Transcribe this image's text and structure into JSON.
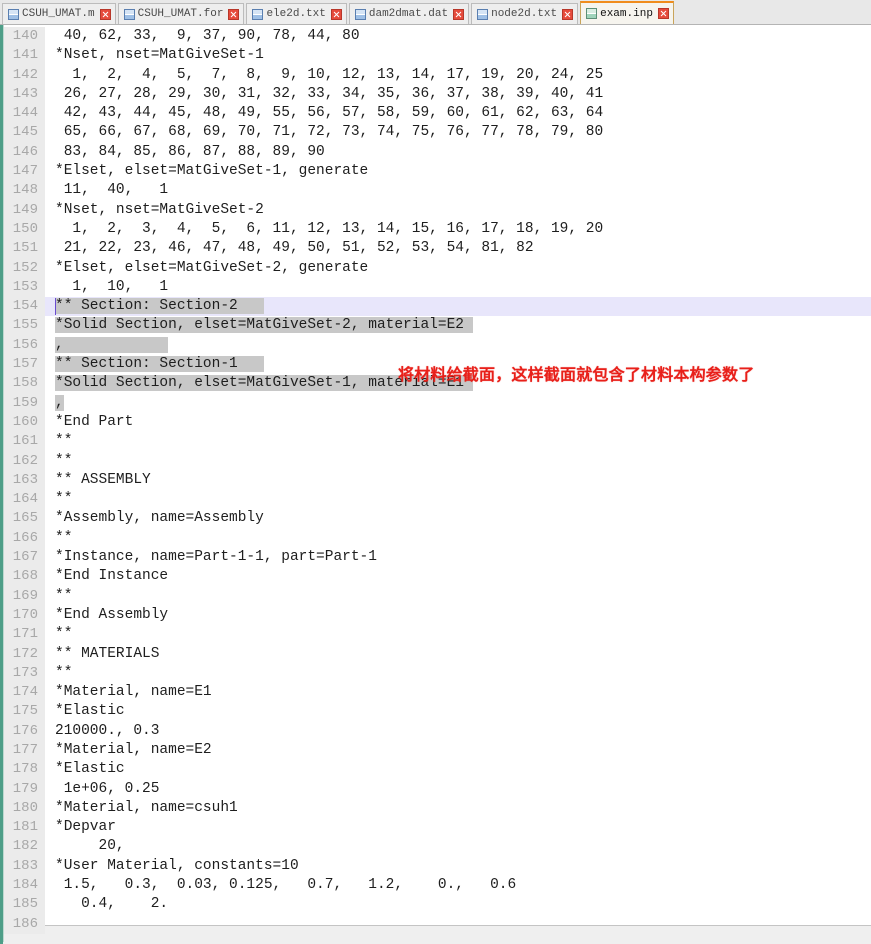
{
  "window": {
    "app_kind": "text-editor",
    "active_file": "exam.inp"
  },
  "colors": {
    "accent_tab_active": "#f08c1c",
    "gutter_bg": "#ebebeb",
    "gutter_text": "#a8a8a8",
    "selection_bg": "#c8c8c8",
    "current_line_bg": "#e8e6fb",
    "annotation_red": "#e8201a",
    "left_rail_green": "#4e9e88",
    "code_text": "#1e1e1e"
  },
  "tabs": [
    {
      "label": "CSUH_UMAT.m",
      "icon": "file-icon",
      "close_icon": "close-icon",
      "active": false
    },
    {
      "label": "CSUH_UMAT.for",
      "icon": "file-icon",
      "close_icon": "close-icon",
      "active": false
    },
    {
      "label": "ele2d.txt",
      "icon": "file-icon",
      "close_icon": "close-icon",
      "active": false
    },
    {
      "label": "dam2dmat.dat",
      "icon": "file-icon",
      "close_icon": "close-icon",
      "active": false
    },
    {
      "label": "node2d.txt",
      "icon": "file-icon",
      "close_icon": "close-icon",
      "active": false
    },
    {
      "label": "exam.inp",
      "icon": "file-icon",
      "close_icon": "close-icon",
      "active": true
    }
  ],
  "annotation": {
    "text": "将材料给截面，这样截面就包含了材料本构参数了"
  },
  "editor": {
    "first_line_number": 140,
    "last_line_number": 186,
    "current_line_number": 154,
    "selection_start_line": 154,
    "selection_end_line": 159,
    "lines": [
      {
        "n": 140,
        "text": " 40, 62, 33,  9, 37, 90, 78, 44, 80",
        "sel": 0
      },
      {
        "n": 141,
        "text": "*Nset, nset=MatGiveSet-1",
        "sel": 0
      },
      {
        "n": 142,
        "text": "  1,  2,  4,  5,  7,  8,  9, 10, 12, 13, 14, 17, 19, 20, 24, 25",
        "sel": 0
      },
      {
        "n": 143,
        "text": " 26, 27, 28, 29, 30, 31, 32, 33, 34, 35, 36, 37, 38, 39, 40, 41",
        "sel": 0
      },
      {
        "n": 144,
        "text": " 42, 43, 44, 45, 48, 49, 55, 56, 57, 58, 59, 60, 61, 62, 63, 64",
        "sel": 0
      },
      {
        "n": 145,
        "text": " 65, 66, 67, 68, 69, 70, 71, 72, 73, 74, 75, 76, 77, 78, 79, 80",
        "sel": 0
      },
      {
        "n": 146,
        "text": " 83, 84, 85, 86, 87, 88, 89, 90",
        "sel": 0
      },
      {
        "n": 147,
        "text": "*Elset, elset=MatGiveSet-1, generate",
        "sel": 0
      },
      {
        "n": 148,
        "text": " 11,  40,   1",
        "sel": 0
      },
      {
        "n": 149,
        "text": "*Nset, nset=MatGiveSet-2",
        "sel": 0
      },
      {
        "n": 150,
        "text": "  1,  2,  3,  4,  5,  6, 11, 12, 13, 14, 15, 16, 17, 18, 19, 20",
        "sel": 0
      },
      {
        "n": 151,
        "text": " 21, 22, 23, 46, 47, 48, 49, 50, 51, 52, 53, 54, 81, 82",
        "sel": 0
      },
      {
        "n": 152,
        "text": "*Elset, elset=MatGiveSet-2, generate",
        "sel": 0
      },
      {
        "n": 153,
        "text": "  1,  10,   1",
        "sel": 0
      },
      {
        "n": 154,
        "text": "** Section: Section-2",
        "sel": 24
      },
      {
        "n": 155,
        "text": "*Solid Section, elset=MatGiveSet-2, material=E2",
        "sel": 48
      },
      {
        "n": 156,
        "text": ",",
        "sel": 13
      },
      {
        "n": 157,
        "text": "** Section: Section-1",
        "sel": 24
      },
      {
        "n": 158,
        "text": "*Solid Section, elset=MatGiveSet-1, material=E1",
        "sel": 48
      },
      {
        "n": 159,
        "text": ",",
        "sel": 1
      },
      {
        "n": 160,
        "text": "*End Part",
        "sel": 0
      },
      {
        "n": 161,
        "text": "**",
        "sel": 0
      },
      {
        "n": 162,
        "text": "**",
        "sel": 0
      },
      {
        "n": 163,
        "text": "** ASSEMBLY",
        "sel": 0
      },
      {
        "n": 164,
        "text": "**",
        "sel": 0
      },
      {
        "n": 165,
        "text": "*Assembly, name=Assembly",
        "sel": 0
      },
      {
        "n": 166,
        "text": "**",
        "sel": 0
      },
      {
        "n": 167,
        "text": "*Instance, name=Part-1-1, part=Part-1",
        "sel": 0
      },
      {
        "n": 168,
        "text": "*End Instance",
        "sel": 0
      },
      {
        "n": 169,
        "text": "**",
        "sel": 0
      },
      {
        "n": 170,
        "text": "*End Assembly",
        "sel": 0
      },
      {
        "n": 171,
        "text": "**",
        "sel": 0
      },
      {
        "n": 172,
        "text": "** MATERIALS",
        "sel": 0
      },
      {
        "n": 173,
        "text": "**",
        "sel": 0
      },
      {
        "n": 174,
        "text": "*Material, name=E1",
        "sel": 0
      },
      {
        "n": 175,
        "text": "*Elastic",
        "sel": 0
      },
      {
        "n": 176,
        "text": "210000., 0.3",
        "sel": 0
      },
      {
        "n": 177,
        "text": "*Material, name=E2",
        "sel": 0
      },
      {
        "n": 178,
        "text": "*Elastic",
        "sel": 0
      },
      {
        "n": 179,
        "text": " 1e+06, 0.25",
        "sel": 0
      },
      {
        "n": 180,
        "text": "*Material, name=csuh1",
        "sel": 0
      },
      {
        "n": 181,
        "text": "*Depvar",
        "sel": 0
      },
      {
        "n": 182,
        "text": "     20,",
        "sel": 0
      },
      {
        "n": 183,
        "text": "*User Material, constants=10",
        "sel": 0
      },
      {
        "n": 184,
        "text": " 1.5,   0.3,  0.03, 0.125,   0.7,   1.2,    0.,   0.6",
        "sel": 0
      },
      {
        "n": 185,
        "text": "   0.4,    2.",
        "sel": 0
      },
      {
        "n": 186,
        "text": "",
        "sel": 0
      }
    ]
  }
}
